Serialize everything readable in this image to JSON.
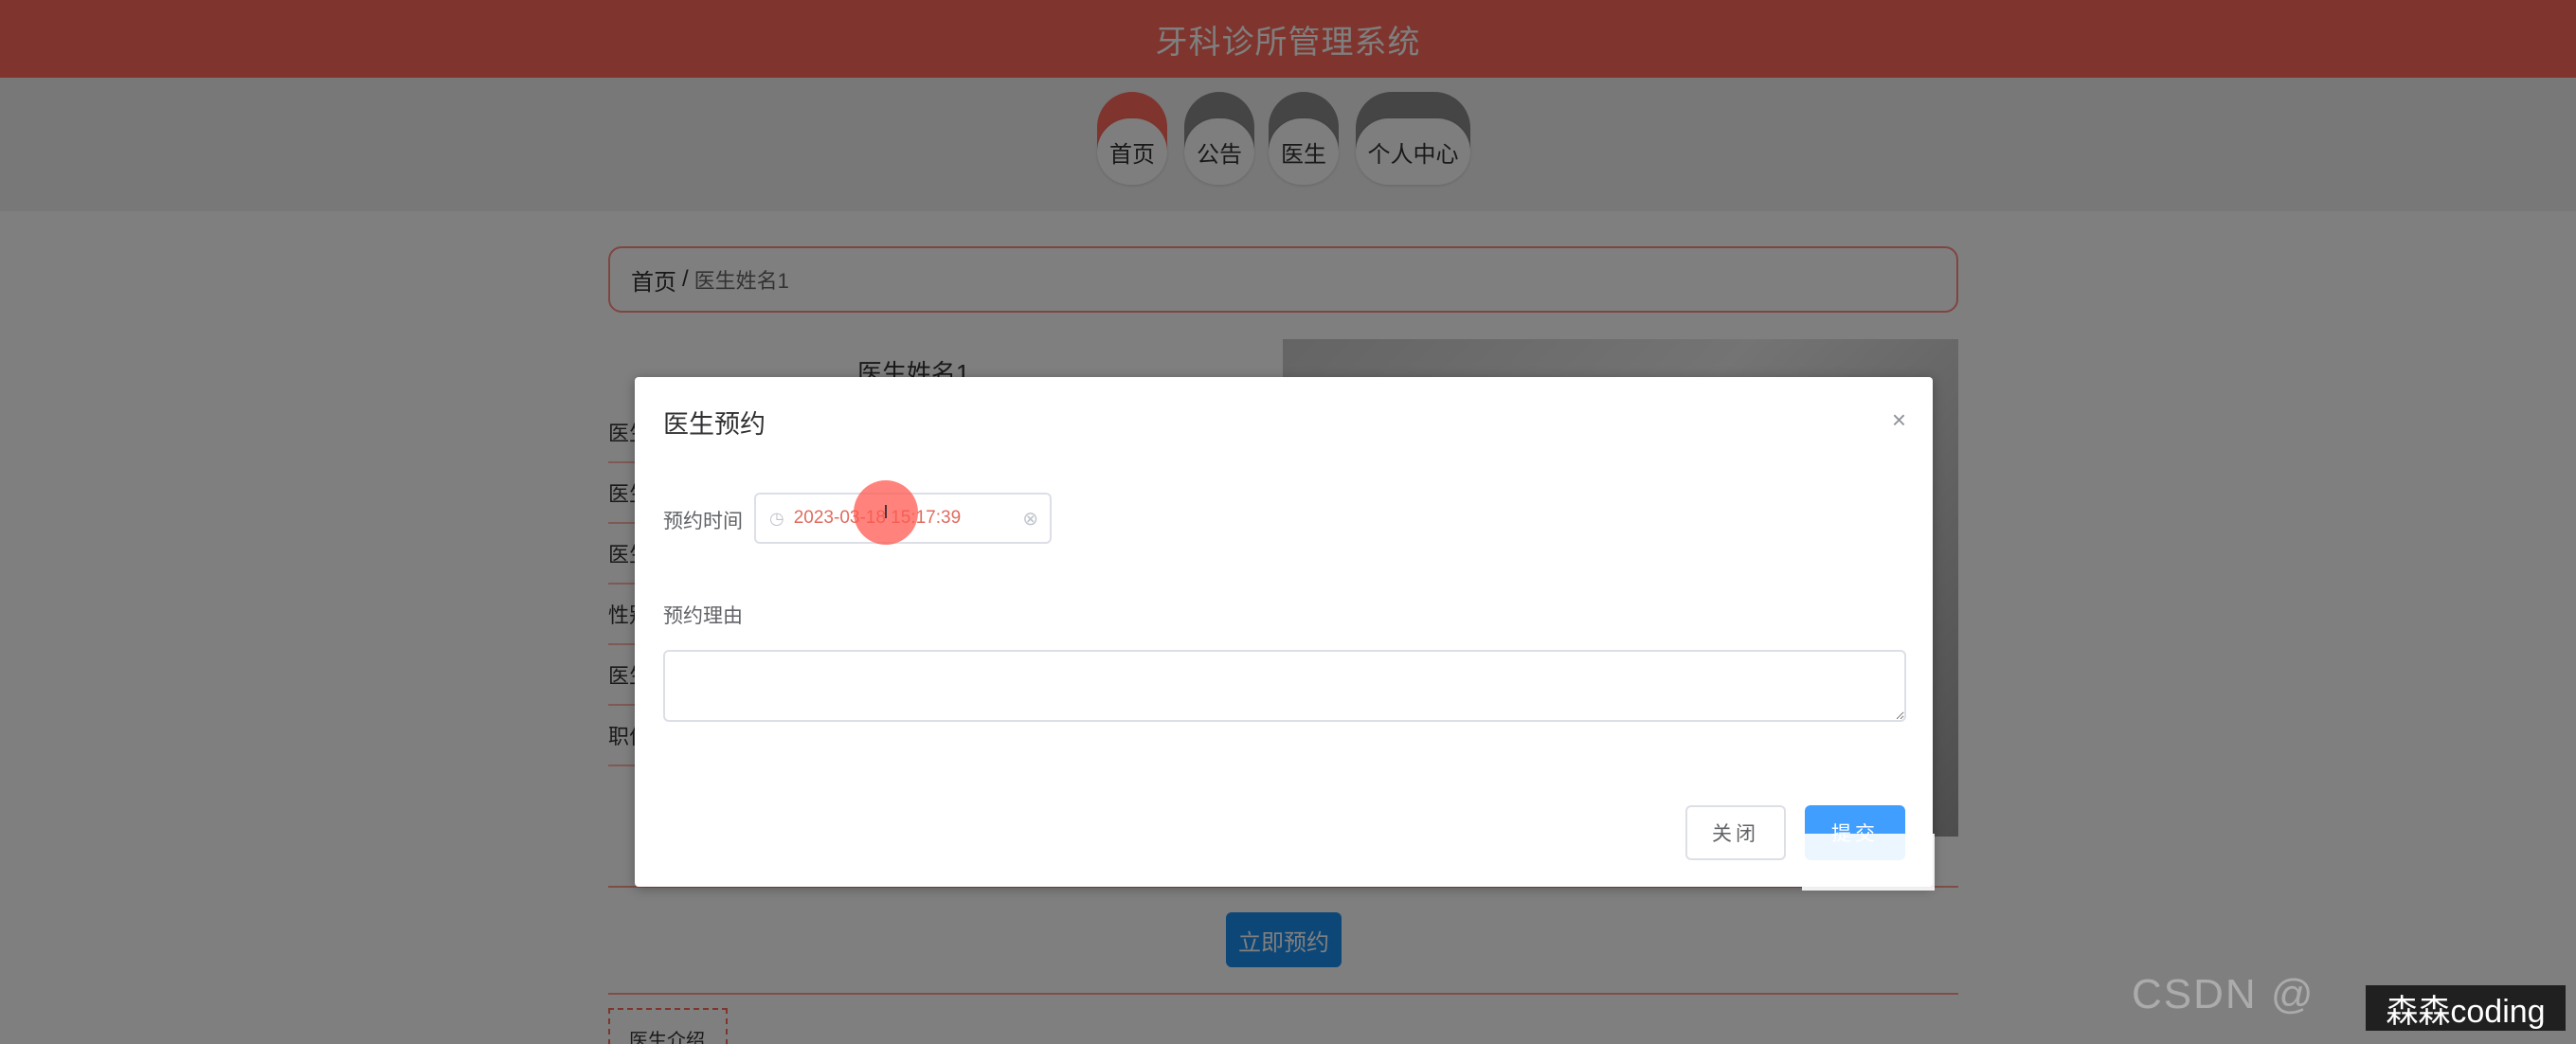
{
  "header": {
    "title": "牙科诊所管理系统"
  },
  "nav": {
    "items": [
      {
        "label": "首页"
      },
      {
        "label": "公告"
      },
      {
        "label": "医生"
      },
      {
        "label": "个人中心"
      }
    ]
  },
  "breadcrumb": {
    "home": "首页",
    "separator": "/",
    "current": "医生姓名1"
  },
  "doctor": {
    "name": "医生姓名1",
    "info_rows": [
      {
        "label": "医生"
      },
      {
        "label": "医生"
      },
      {
        "label": "医生"
      },
      {
        "label": "性别"
      },
      {
        "label": "医生"
      },
      {
        "label": "职位"
      }
    ],
    "book_button": "立即预约",
    "intro_tab": "医生介绍"
  },
  "modal": {
    "title": "医生预约",
    "close_symbol": "×",
    "fields": {
      "time_label": "预约时间",
      "time_value": "2023-03-18 15:17:39",
      "reason_label": "预约理由",
      "reason_value": ""
    },
    "buttons": {
      "close": "关闭",
      "submit": "提交"
    }
  },
  "watermark": {
    "csdn": "CSDN @",
    "author": "森森coding"
  },
  "colors": {
    "brand": "#ff6a5b",
    "primary": "#409eff",
    "book_button": "#1a8ef0"
  },
  "icons": {
    "time_field": "clock-icon",
    "clear_field": "circle-close-icon",
    "dialog_close": "close-icon"
  }
}
